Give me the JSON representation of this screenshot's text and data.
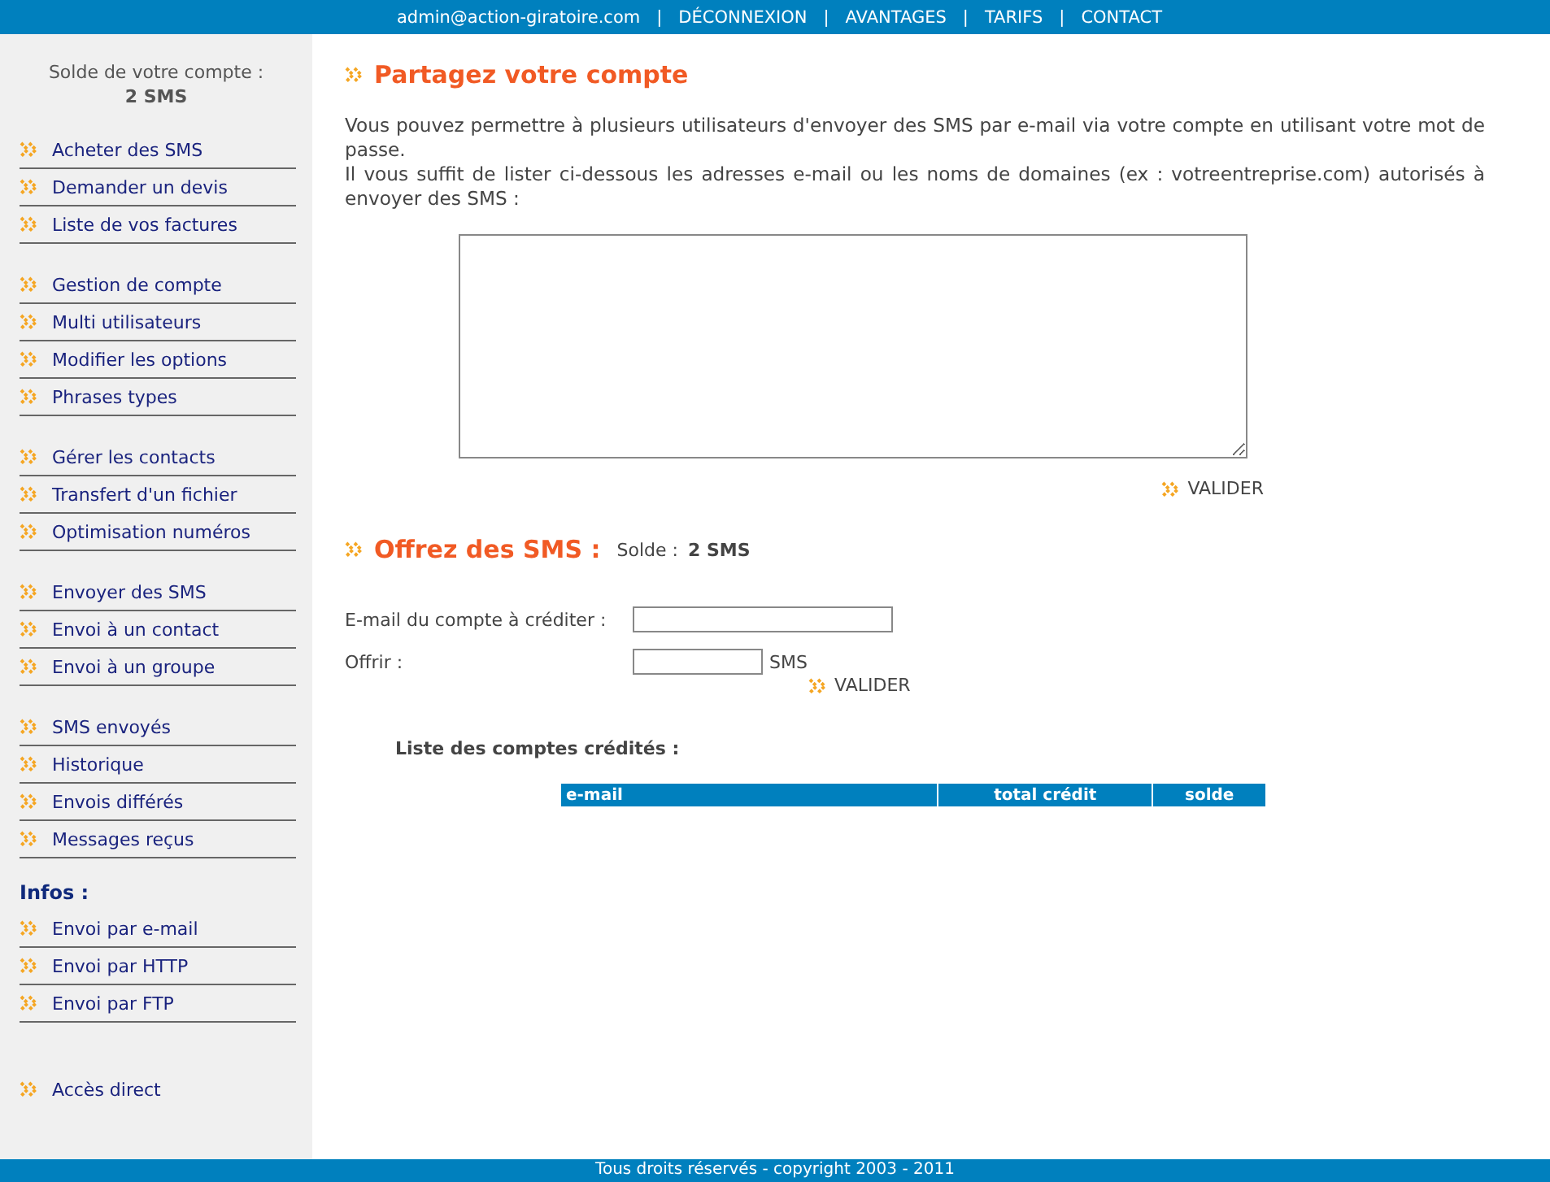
{
  "top_nav": {
    "account": "admin@action-giratoire.com",
    "links": [
      {
        "separator": "|",
        "label": "DÉCONNEXION"
      },
      {
        "separator": "|",
        "label": "AVANTAGES"
      },
      {
        "separator": "|",
        "label": "TARIFS"
      },
      {
        "separator": "|",
        "label": "CONTACT"
      }
    ]
  },
  "sidebar": {
    "balance_label": "Solde de votre compte :",
    "balance_value": "2 SMS",
    "groups": [
      {
        "items": [
          "Acheter des SMS",
          "Demander un devis",
          "Liste de vos factures"
        ]
      },
      {
        "items": [
          "Gestion de compte",
          "Multi utilisateurs",
          "Modifier les options",
          "Phrases types"
        ]
      },
      {
        "items": [
          "Gérer les contacts",
          "Transfert d'un fichier",
          "Optimisation numéros"
        ]
      },
      {
        "items": [
          "Envoyer des SMS",
          "Envoi à un contact",
          "Envoi à un groupe"
        ]
      },
      {
        "items": [
          "SMS envoyés",
          "Historique",
          "Envois différés",
          "Messages reçus"
        ]
      },
      {
        "heading": "Infos :",
        "items": [
          "Envoi par e-mail",
          "Envoi par HTTP",
          "Envoi par FTP"
        ]
      }
    ],
    "direct_link": "Accès direct"
  },
  "share_section": {
    "title": "Partagez votre compte",
    "paragraphs": [
      "Vous pouvez permettre à plusieurs utilisateurs d'envoyer des SMS par e-mail via votre compte en utilisant votre mot de passe.",
      "Il vous suffit de lister ci-dessous les adresses e-mail ou les noms de domaines (ex : votreentreprise.com) autorisés à envoyer des SMS :"
    ],
    "submit": "VALIDER"
  },
  "offer_section": {
    "title": "Offrez des SMS :",
    "balance_label": "Solde :",
    "balance_value": "2 SMS",
    "email_label": "E-mail du compte à créditer :",
    "amount_label": "Offrir :",
    "amount_unit": "SMS",
    "submit": "VALIDER",
    "list_heading": "Liste des comptes crédités :",
    "table": {
      "columns": [
        "e-mail",
        "total crédit",
        "solde"
      ]
    }
  },
  "footer": "Tous droits réservés - copyright 2003 - 2011"
}
